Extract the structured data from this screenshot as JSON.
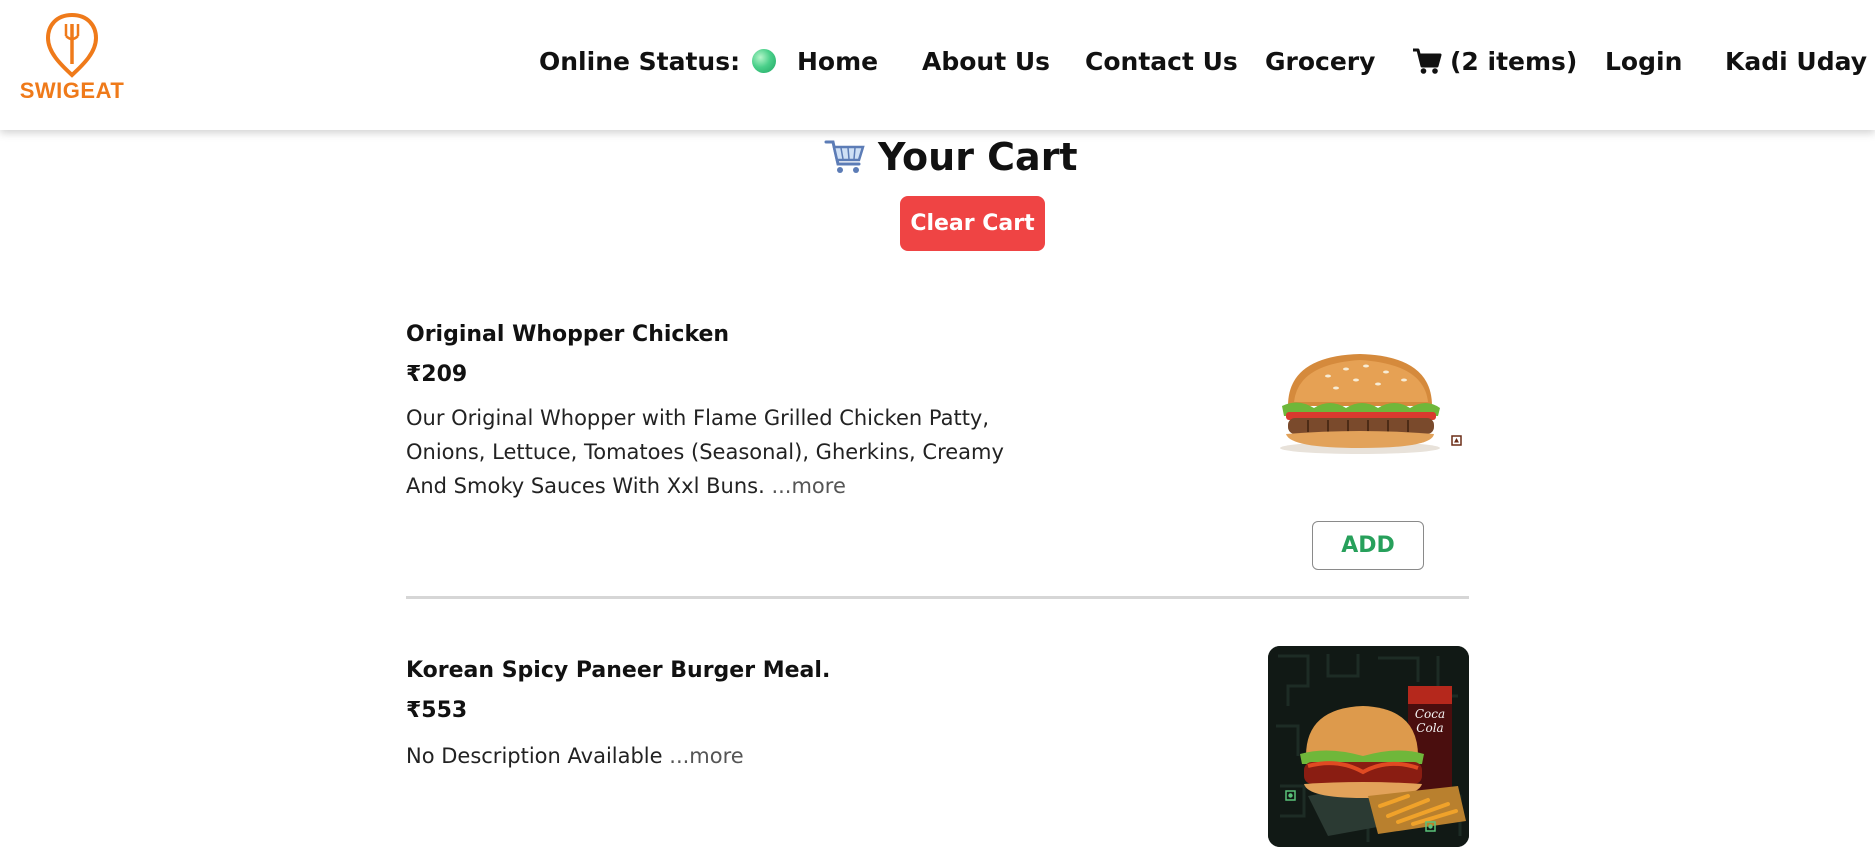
{
  "brand": {
    "name": "SWIGEAT",
    "color": "#ef7a1a"
  },
  "nav": {
    "online_status_label": "Online Status:",
    "status_color": "#3cc47c",
    "home": "Home",
    "about": "About Us",
    "contact": "Contact Us",
    "grocery": "Grocery",
    "cart": "(2 items)",
    "login": "Login",
    "user": "Kadi Uday"
  },
  "cart": {
    "title": "Your Cart",
    "clear_label": "Clear Cart",
    "clear_color": "#ef4444"
  },
  "items": [
    {
      "name": "Original Whopper Chicken",
      "price": "₹209",
      "description": "Our Original Whopper with Flame Grilled Chicken Patty, Onions, Lettuce, Tomatoes (Seasonal), Gherkins, Creamy And Smoky Sauces With Xxl Buns.",
      "more": "...more",
      "add_label": "ADD",
      "image": "burger-image"
    },
    {
      "name": "Korean Spicy Paneer Burger Meal.",
      "price": "₹553",
      "description": "No Description Available",
      "more": "...more",
      "image": "burger-meal-image"
    }
  ],
  "icons": {
    "cart_icon": "cart-icon",
    "title_icon": "shopping-cart-icon",
    "logo_icon": "fork-pin-icon"
  }
}
